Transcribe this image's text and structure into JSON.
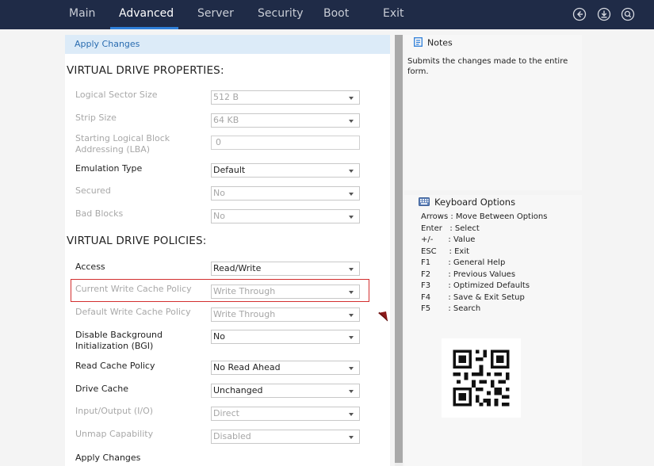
{
  "nav": {
    "tabs": [
      {
        "label": "Main",
        "active": false
      },
      {
        "label": "Advanced",
        "active": true
      },
      {
        "label": "Server",
        "active": false
      },
      {
        "label": "Security",
        "active": false
      },
      {
        "label": "Boot",
        "active": false
      },
      {
        "label": "Exit",
        "active": false
      }
    ],
    "icons": [
      "back-icon",
      "save-icon",
      "search-icon"
    ]
  },
  "form": {
    "apply_top": "Apply Changes",
    "section_properties": "VIRTUAL DRIVE PROPERTIES:",
    "logical_sector_size": {
      "label": "Logical Sector Size",
      "value": "512 B"
    },
    "strip_size": {
      "label": "Strip Size",
      "value": "64 KB"
    },
    "starting_lba": {
      "label": "Starting Logical Block Addressing (LBA)",
      "value": "0"
    },
    "emulation_type": {
      "label": "Emulation Type",
      "value": "Default"
    },
    "secured": {
      "label": "Secured",
      "value": "No"
    },
    "bad_blocks": {
      "label": "Bad Blocks",
      "value": "No"
    },
    "section_policies": "VIRTUAL DRIVE POLICIES:",
    "access": {
      "label": "Access",
      "value": "Read/Write"
    },
    "current_write_cache": {
      "label": "Current Write Cache Policy",
      "value": "Write Through"
    },
    "default_write_cache": {
      "label": "Default Write Cache Policy",
      "value": "Write Through"
    },
    "disable_bgi": {
      "label": "Disable Background Initialization (BGI)",
      "value": "No"
    },
    "read_cache": {
      "label": "Read Cache Policy",
      "value": "No Read Ahead"
    },
    "drive_cache": {
      "label": "Drive Cache",
      "value": "Unchanged"
    },
    "io": {
      "label": "Input/Output (I/O)",
      "value": "Direct"
    },
    "unmap": {
      "label": "Unmap Capability",
      "value": "Disabled"
    },
    "apply_bottom": "Apply Changes"
  },
  "notes": {
    "title": "Notes",
    "body": "Submits the changes made to the entire form."
  },
  "keyboard": {
    "title": "Keyboard Options",
    "lines": [
      "Arrows : Move Between Options",
      "Enter   : Select",
      "+/-      : Value",
      "ESC     : Exit",
      "F1       : General Help",
      "F2       : Previous Values",
      "F3       : Optimized Defaults",
      "F4       : Save & Exit Setup",
      "F5       : Search"
    ]
  },
  "colors": {
    "topbar": "#1f2b47",
    "accent": "#2f7fd9",
    "highlight": "#d32f2f"
  }
}
